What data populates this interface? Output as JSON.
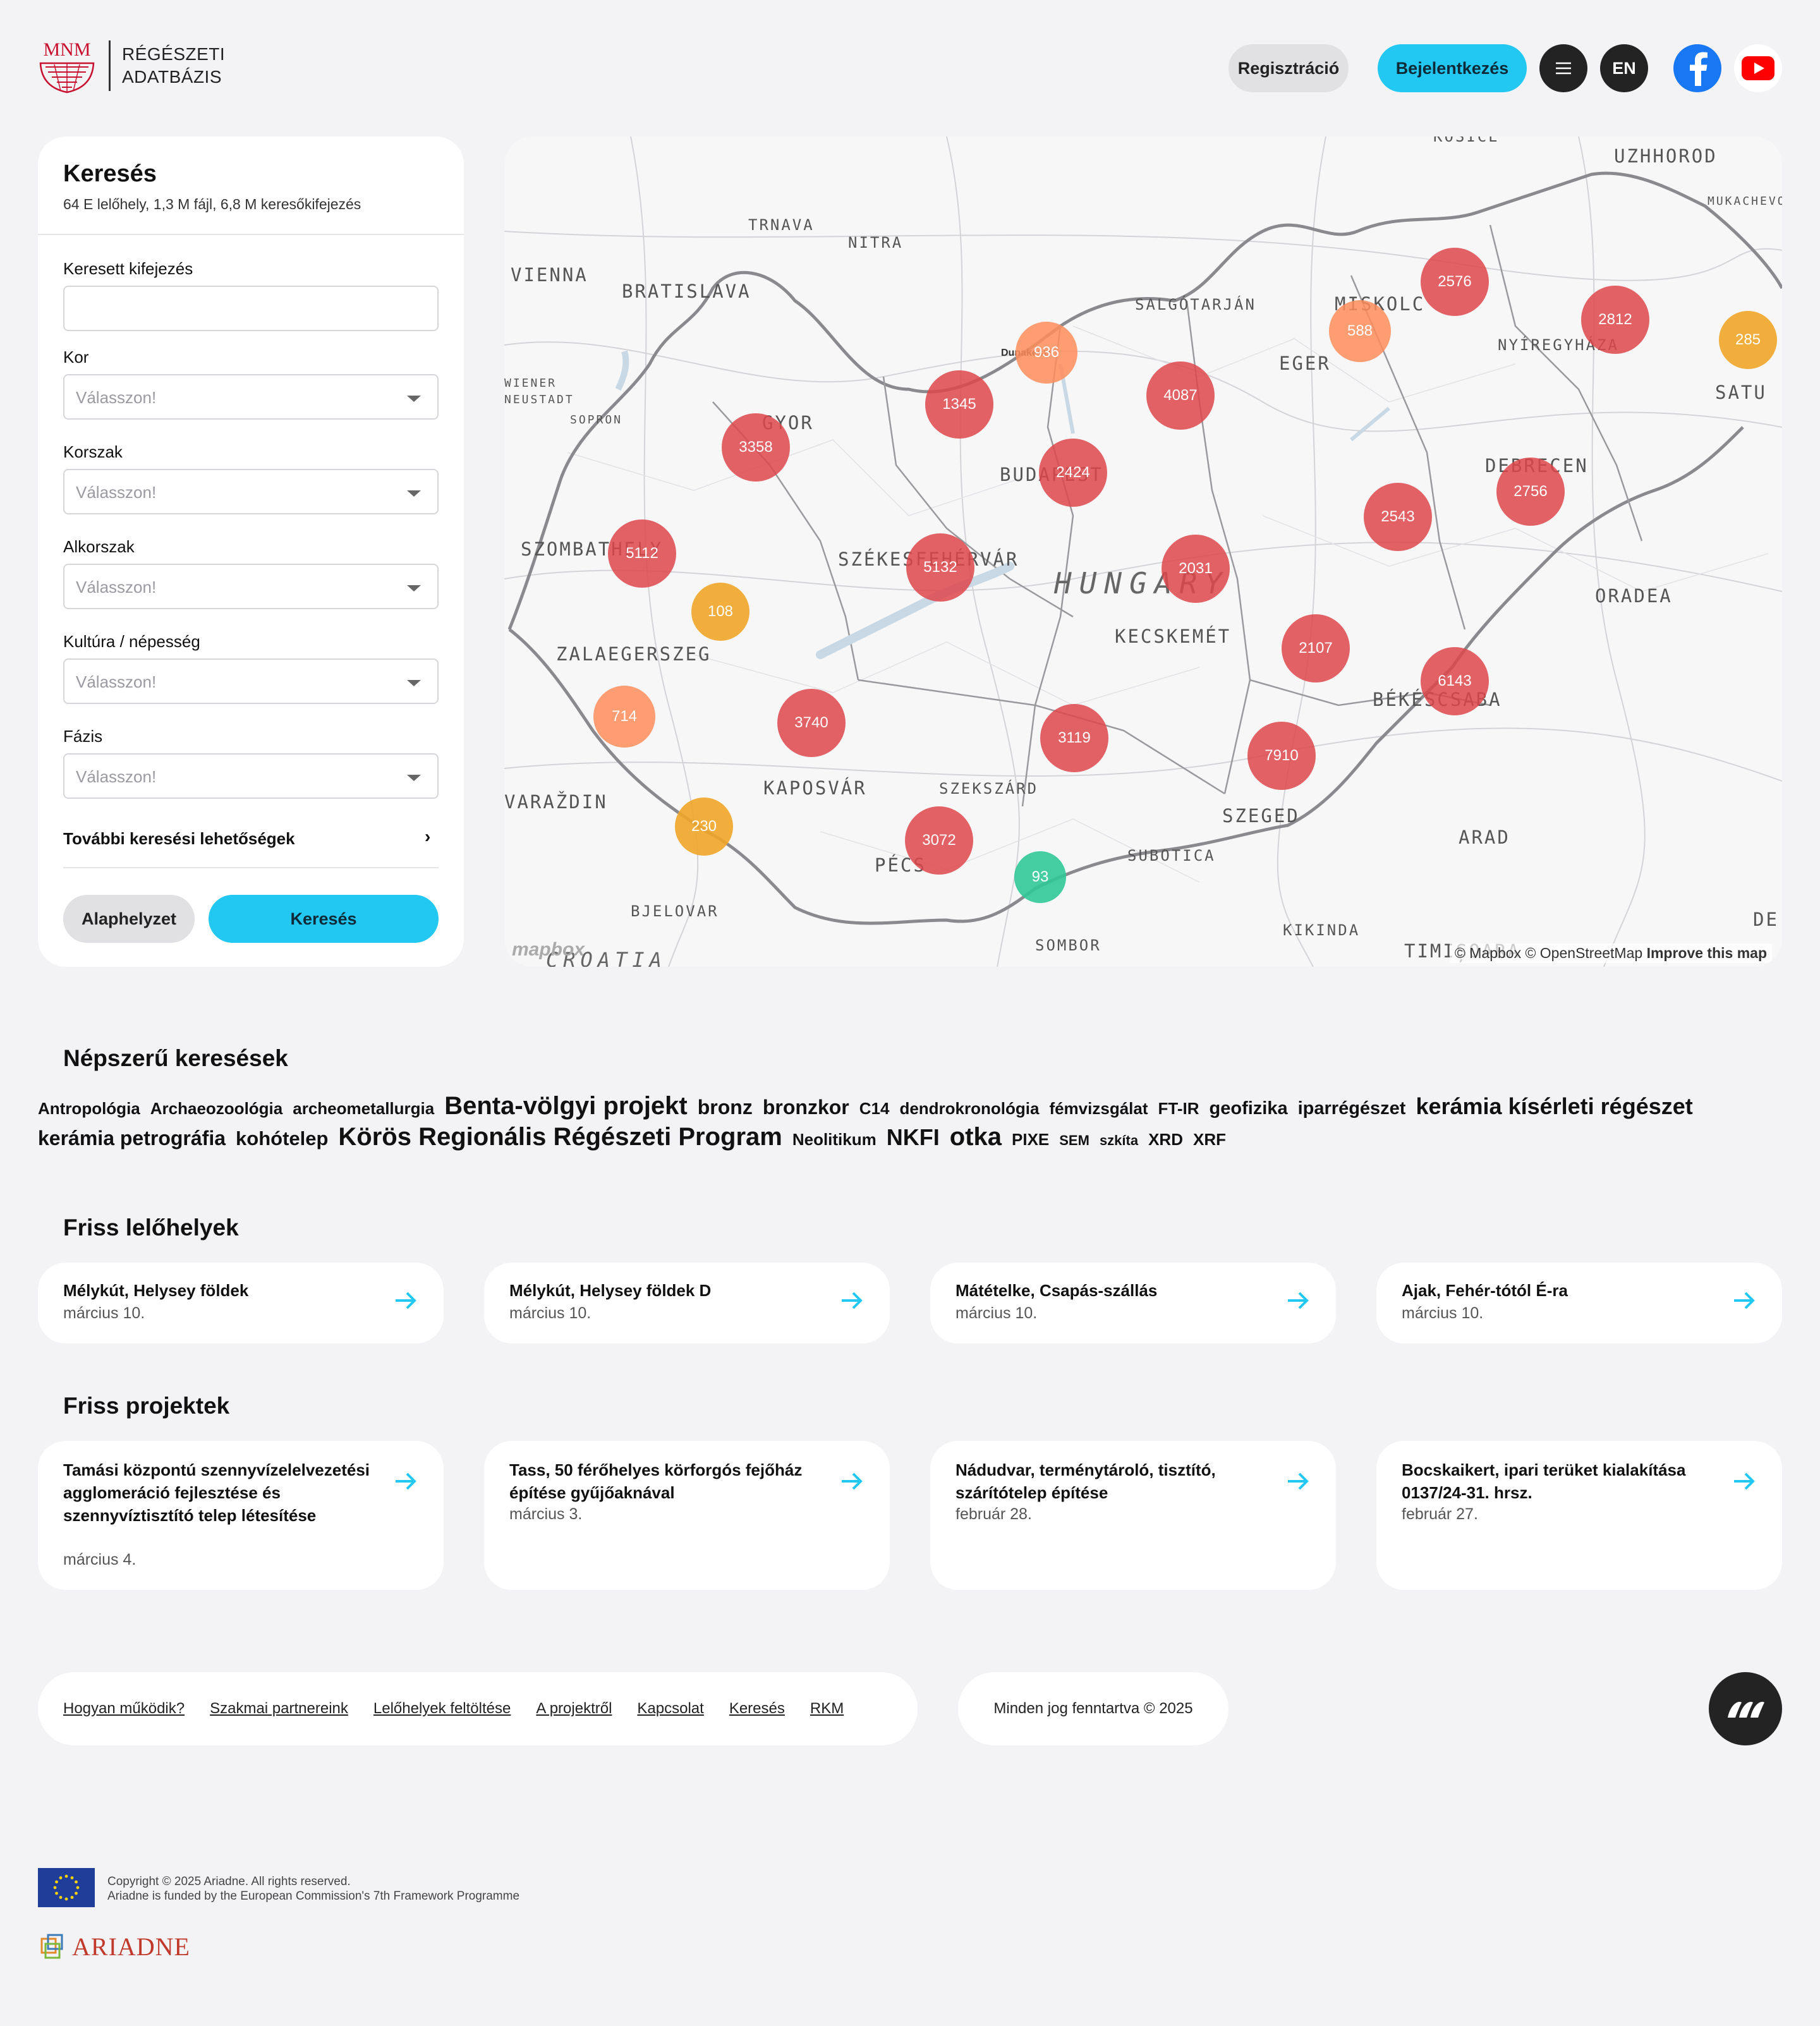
{
  "header": {
    "logo_title_line1": "RÉGÉSZETI",
    "logo_title_line2": "ADATBÁZIS",
    "logo_mark": "MNM",
    "register_label": "Regisztráció",
    "login_label": "Bejelentkezés",
    "lang_label": "EN",
    "menu_icon": "hamburger-icon",
    "facebook_icon": "facebook-icon",
    "youtube_icon": "youtube-icon"
  },
  "search": {
    "title": "Keresés",
    "subtitle": "64 E lelőhely, 1,3 M fájl, 6,8 M keresőkifejezés",
    "query_label": "Keresett kifejezés",
    "query_value": "",
    "fields": [
      {
        "label": "Kor",
        "placeholder": "Válasszon!"
      },
      {
        "label": "Korszak",
        "placeholder": "Válasszon!"
      },
      {
        "label": "Alkorszak",
        "placeholder": "Válasszon!"
      },
      {
        "label": "Kultúra / népesség",
        "placeholder": "Válasszon!"
      },
      {
        "label": "Fázis",
        "placeholder": "Válasszon!"
      }
    ],
    "more_label": "További keresési lehetőségek",
    "more_chevron": "›",
    "reset_label": "Alaphelyzet",
    "submit_label": "Keresés"
  },
  "map": {
    "country_label": "HUNGARY",
    "cities": [
      "KOSICE",
      "UZHHOROD",
      "MUKACHEVO",
      "TRNAVA",
      "NITRA",
      "VIENNA",
      "BRATISLAVA",
      "SALGÓTARJÁN",
      "MISKOLC",
      "NYÍREGYHÁZA",
      "EGER",
      "SATU",
      "WIENER NEUSTADT",
      "SOPRON",
      "GYOR",
      "Dunakeszi",
      "BUDAPEST",
      "DEBRECEN",
      "SZOMBATHELY",
      "SZÉKESFEHÉRVÁR",
      "ORADEA",
      "KECSKEMÉT",
      "ZALAEGERSZEG",
      "BÉKÉSCSABA",
      "KAPOSVÁR",
      "SZEKSZÁRD",
      "VARAŽDIN",
      "SZEGED",
      "ARAD",
      "PÉCS",
      "SUBOTICA",
      "BJELOVAR",
      "KIKINDA",
      "SOMBOR",
      "CROATIA",
      "TIMIȘOARA",
      "DE"
    ],
    "clusters": [
      {
        "count": "2576",
        "color": "red"
      },
      {
        "count": "2812",
        "color": "red"
      },
      {
        "count": "285",
        "color": "yellow"
      },
      {
        "count": "588",
        "color": "orange"
      },
      {
        "count": "936",
        "color": "orange"
      },
      {
        "count": "4087",
        "color": "red"
      },
      {
        "count": "1345",
        "color": "red"
      },
      {
        "count": "3358",
        "color": "red"
      },
      {
        "count": "2424",
        "color": "red"
      },
      {
        "count": "2756",
        "color": "red"
      },
      {
        "count": "2543",
        "color": "red"
      },
      {
        "count": "5112",
        "color": "red"
      },
      {
        "count": "5132",
        "color": "red"
      },
      {
        "count": "2031",
        "color": "red"
      },
      {
        "count": "108",
        "color": "yellow"
      },
      {
        "count": "2107",
        "color": "red"
      },
      {
        "count": "6143",
        "color": "red"
      },
      {
        "count": "714",
        "color": "orange"
      },
      {
        "count": "3740",
        "color": "red"
      },
      {
        "count": "3119",
        "color": "red"
      },
      {
        "count": "7910",
        "color": "red"
      },
      {
        "count": "230",
        "color": "yellow"
      },
      {
        "count": "3072",
        "color": "red"
      },
      {
        "count": "93",
        "color": "green"
      }
    ],
    "attribution_prefix": "© Mapbox © OpenStreetMap",
    "attribution_link": "Improve this map",
    "mapbox_logo": "mapbox"
  },
  "popular": {
    "title": "Népszerű keresések",
    "tags": [
      {
        "text": "Antropológia",
        "size": 1
      },
      {
        "text": "Archaeozoológia",
        "size": 1
      },
      {
        "text": "archeometallurgia",
        "size": 1
      },
      {
        "text": "Benta-völgyi projekt",
        "size": 3
      },
      {
        "text": "bronz",
        "size": 2
      },
      {
        "text": "bronzkor",
        "size": 2
      },
      {
        "text": "C14",
        "size": 1
      },
      {
        "text": "dendrokronológia",
        "size": 1
      },
      {
        "text": "fémvizsgálat",
        "size": 1
      },
      {
        "text": "FT-IR",
        "size": 1
      },
      {
        "text": "geofizika",
        "size": 1.5
      },
      {
        "text": "iparrégészet",
        "size": 1.5
      },
      {
        "text": "kerámia kísérleti régészet",
        "size": 2.5
      },
      {
        "text": "kerámia petrográfia",
        "size": 2
      },
      {
        "text": "kohótelep",
        "size": 1.8
      },
      {
        "text": "Körös Regionális Régészeti Program",
        "size": 3
      },
      {
        "text": "Neolitikum",
        "size": 1
      },
      {
        "text": "NKFI",
        "size": 2.5
      },
      {
        "text": "otka",
        "size": 3
      },
      {
        "text": "PIXE",
        "size": 1
      },
      {
        "text": "SEM",
        "size": 0.8
      },
      {
        "text": "szkíta",
        "size": 0.8
      },
      {
        "text": "XRD",
        "size": 1
      },
      {
        "text": "XRF",
        "size": 1
      }
    ]
  },
  "recent_sites": {
    "title": "Friss lelőhelyek",
    "items": [
      {
        "title": "Mélykút, Helysey földek",
        "date": "március 10."
      },
      {
        "title": "Mélykút, Helysey földek D",
        "date": "március 10."
      },
      {
        "title": "Mátételke, Csapás-szállás",
        "date": "március 10."
      },
      {
        "title": "Ajak, Fehér-tótól É-ra",
        "date": "március 10."
      }
    ]
  },
  "recent_projects": {
    "title": "Friss projektek",
    "items": [
      {
        "title": "Tamási központú szennyvízelelvezetési agglomeráció fejlesztése és szennyvíztisztító telep létesítése",
        "date": "március 4."
      },
      {
        "title": "Tass, 50 férőhelyes körforgós fejőház építése gyűjőaknával",
        "date": "március 3."
      },
      {
        "title": "Nádudvar, terménytároló, tisztító, szárítótelep építése",
        "date": "február 28."
      },
      {
        "title": "Bocskaikert, ipari terüket kialakítása 0137/24-31. hrsz.",
        "date": "február 27."
      }
    ]
  },
  "footer": {
    "links": [
      "Hogyan működik?",
      "Szakmai partnereink",
      "Lelőhelyek feltöltése",
      "A projektről",
      "Kapcsolat",
      "Keresés",
      "RKM"
    ],
    "copyright": "Minden jog fenntartva © 2025",
    "eu_line1": "Copyright © 2025 Ariadne. All rights reserved.",
    "eu_line2": "Ariadne is funded by the European Commission's 7th Framework Programme",
    "ariadne_logo": "ARIADNE"
  },
  "colors": {
    "accent": "#22c8f2",
    "dark": "#232323",
    "cluster_red": "#de464b",
    "cluster_orange": "#ff8c5a",
    "cluster_yellow": "#f0a528",
    "cluster_green": "#30c896"
  }
}
